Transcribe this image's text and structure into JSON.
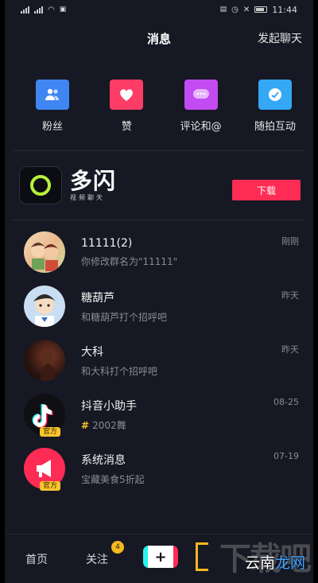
{
  "status_bar": {
    "time": "11:44"
  },
  "header": {
    "title": "消息",
    "action_label": "发起聊天"
  },
  "quick_actions": [
    {
      "label": "粉丝",
      "icon": "fans-icon",
      "color": "#3f86f3"
    },
    {
      "label": "赞",
      "icon": "heart-icon",
      "color": "#fe3d67"
    },
    {
      "label": "评论和@",
      "icon": "comment-icon",
      "color": "#c34bf2"
    },
    {
      "label": "随拍互动",
      "icon": "snap-interact-icon",
      "color": "#34a7f5"
    }
  ],
  "banner": {
    "app_name": "多闪",
    "app_subtitle": "视频聊天",
    "download_label": "下载"
  },
  "conversations": [
    {
      "name": "11111(2)",
      "message": "你修改群名为\"11111\"",
      "time": "刚刚",
      "official": false
    },
    {
      "name": "糖葫芦",
      "message": "和糖葫芦打个招呼吧",
      "time": "昨天",
      "official": false
    },
    {
      "name": "大科",
      "message": "和大科打个招呼吧",
      "time": "昨天",
      "official": false
    },
    {
      "name": "抖音小助手",
      "message_tag": "#",
      "message": "2002舞",
      "time": "08-25",
      "official": true,
      "official_label": "官方"
    },
    {
      "name": "系统消息",
      "message": "宝藏美食5折起",
      "time": "07-19",
      "official": true,
      "official_label": "官方"
    }
  ],
  "tabbar": {
    "home": "首页",
    "follow": "关注",
    "follow_badge": "4",
    "plus": "+"
  },
  "watermark": {
    "back": "下载吧",
    "front_a": "云南",
    "front_b": "龙网"
  },
  "colors": {
    "background": "#161823",
    "accent": "#fe2c55",
    "badge": "#f5b81f"
  }
}
